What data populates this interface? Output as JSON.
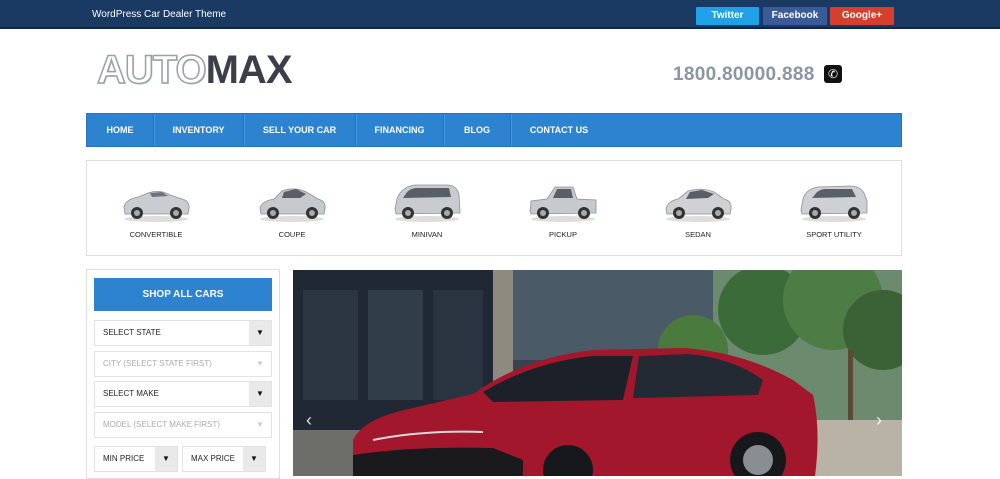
{
  "topbar": {
    "tagline": "WordPress Car Dealer Theme",
    "social": [
      {
        "label": "Twitter",
        "color": "#1ea1e6"
      },
      {
        "label": "Facebook",
        "color": "#3b5a98"
      },
      {
        "label": "Google+",
        "color": "#d63e2e"
      }
    ]
  },
  "header": {
    "logo_part1": "AUTO",
    "logo_part2": "MAX",
    "phone": "1800.80000.888",
    "phone_icon": "phone-icon"
  },
  "nav": {
    "items": [
      {
        "label": "HOME"
      },
      {
        "label": "INVENTORY"
      },
      {
        "label": "SELL YOUR CAR"
      },
      {
        "label": "FINANCING"
      },
      {
        "label": "BLOG"
      },
      {
        "label": "CONTACT US"
      }
    ],
    "color": "#2e83d0"
  },
  "body_types": [
    {
      "label": "CONVERTIBLE"
    },
    {
      "label": "COUPE"
    },
    {
      "label": "MINIVAN"
    },
    {
      "label": "PICKUP"
    },
    {
      "label": "SEDAN"
    },
    {
      "label": "SPORT UTILITY"
    }
  ],
  "search": {
    "shop_all": "SHOP ALL CARS",
    "select_state": "SELECT STATE",
    "city": "CITY (SELECT STATE FIRST)",
    "select_make": "SELECT MAKE",
    "model": "MODEL (SELECT MAKE FIRST)",
    "min_price": "MIN PRICE",
    "max_price": "MAX PRICE"
  },
  "hero": {
    "prev_icon": "chevron-left-icon",
    "next_icon": "chevron-right-icon",
    "prev_glyph": "‹",
    "next_glyph": "›"
  }
}
